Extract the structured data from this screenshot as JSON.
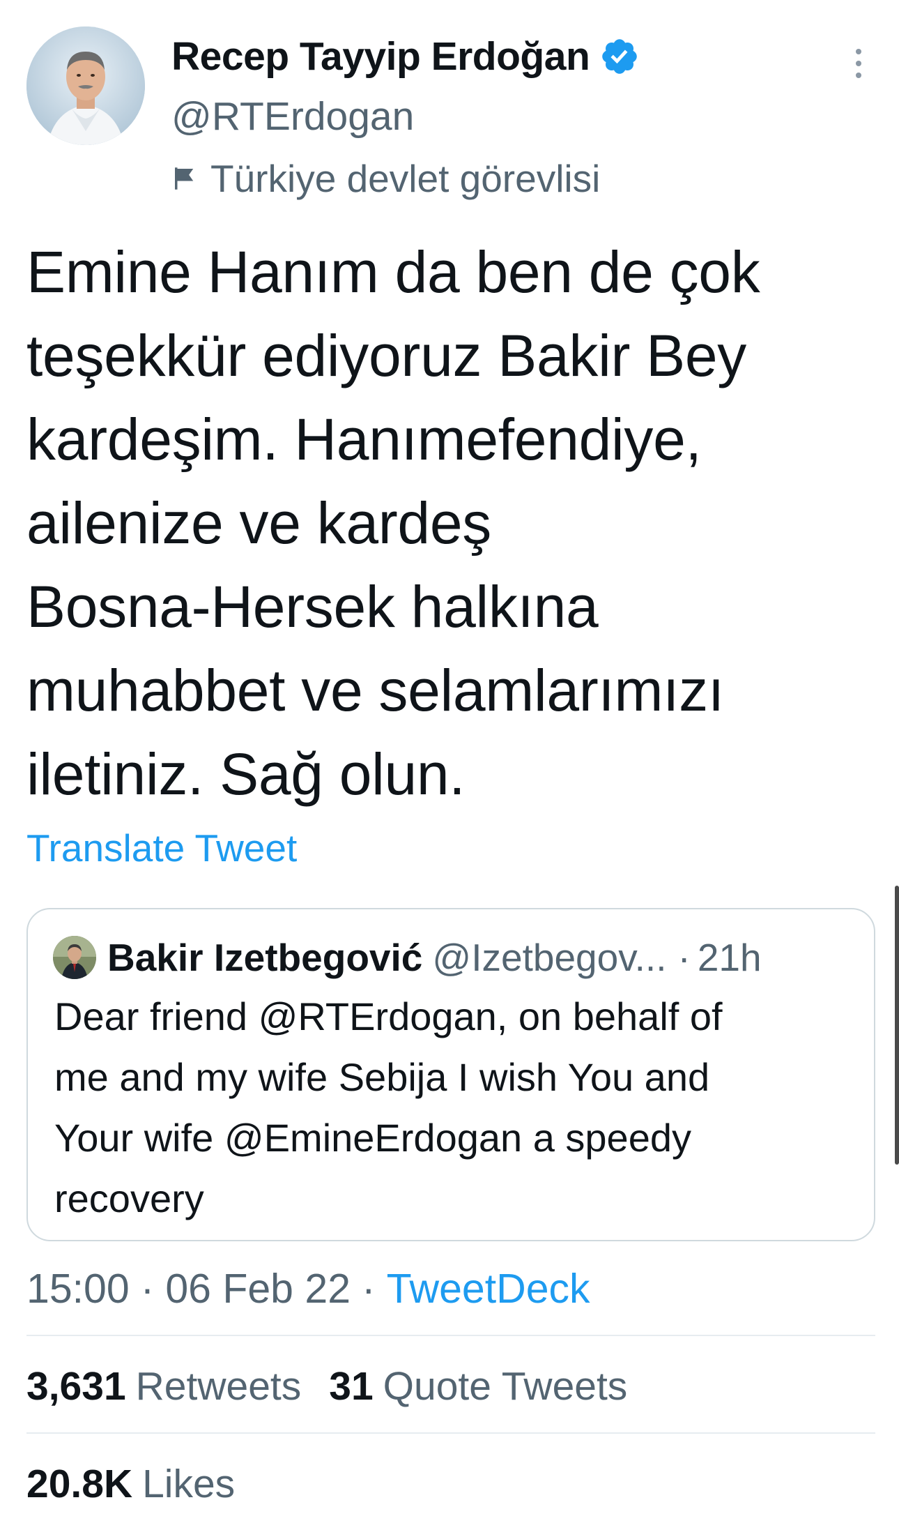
{
  "tweet": {
    "author": {
      "display_name": "Recep Tayyip Erdoğan",
      "handle": "@RTErdogan",
      "verified": true,
      "label": "Türkiye devlet görevlisi",
      "avatar_icon": "profile-photo"
    },
    "text": "Emine Hanım da ben de çok\nteşekkür ediyoruz Bakir Bey\nkardeşim. Hanımefendiye,\nailenize ve kardeş\nBosna-Hersek halkına\nmuhabbet ve selamlarımızı\niletiniz. Sağ olun.",
    "translate_label": "Translate Tweet",
    "quote": {
      "display_name": "Bakir Izetbegović",
      "handle": "@Izetbegov...",
      "separator": "·",
      "time": "21h",
      "text": "Dear friend @RTErdogan, on behalf of\nme and my wife Sebija I wish You and\nYour wife @EmineErdogan a speedy\nrecovery"
    },
    "meta": {
      "time": "15:00",
      "separator": "·",
      "date": "06 Feb 22",
      "source": "TweetDeck"
    },
    "stats": {
      "retweets_count": "3,631",
      "retweets_label": "Retweets",
      "quotes_count": "31",
      "quotes_label": "Quote Tweets",
      "likes_count": "20.8K",
      "likes_label": "Likes"
    }
  },
  "colors": {
    "accent": "#1d9bf0",
    "text_primary": "#0f1419",
    "text_secondary": "#536471",
    "border": "#cfd9de"
  }
}
